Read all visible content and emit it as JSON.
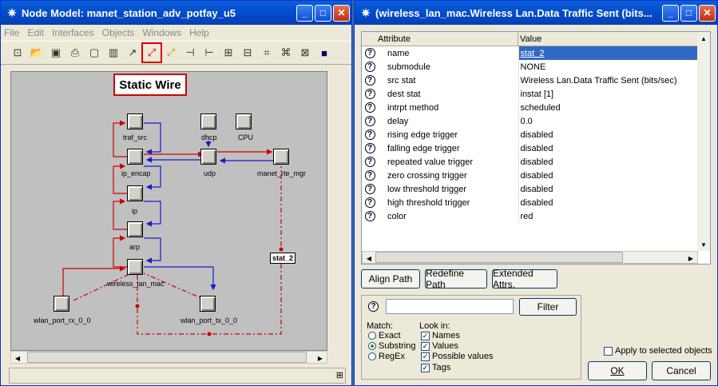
{
  "left_window": {
    "title": "Node Model: manet_station_adv_potfay_u5",
    "menu": [
      "File",
      "Edit",
      "Interfaces",
      "Objects",
      "Windows",
      "Help"
    ],
    "tooltip": "Static Wire",
    "nodes": {
      "traf_src": "traf_src",
      "ip_encap": "ip_encap",
      "ip": "ip",
      "arp": "arp",
      "wireless_lan_mac": "wireless_lan_mac",
      "dhcp": "dhcp",
      "cpu": "CPU",
      "udp": "udp",
      "manet_rte_mgr": "manet_rte_mgr",
      "wlan_port_rx": "wlan_port_rx_0_0",
      "wlan_port_tx": "wlan_port_tx_0_0",
      "stat_tag": "stat_2"
    },
    "colors": {
      "wire_red": "#cc0000",
      "wire_blue": "#1a1acc",
      "highlight": "#d00000"
    }
  },
  "right_window": {
    "title": "(wireless_lan_mac.Wireless Lan.Data Traffic Sent (bits...",
    "columns": {
      "attribute": "Attribute",
      "value": "Value"
    },
    "rows": [
      {
        "name": "name",
        "value": "stat_2"
      },
      {
        "name": "submodule",
        "value": "NONE"
      },
      {
        "name": "src stat",
        "value": "Wireless Lan.Data Traffic Sent (bits/sec)"
      },
      {
        "name": "dest stat",
        "value": "instat [1]"
      },
      {
        "name": "intrpt method",
        "value": "scheduled"
      },
      {
        "name": "delay",
        "value": "0.0"
      },
      {
        "name": "rising edge trigger",
        "value": "disabled"
      },
      {
        "name": "falling edge trigger",
        "value": "disabled"
      },
      {
        "name": "repeated value trigger",
        "value": "disabled"
      },
      {
        "name": "zero crossing trigger",
        "value": "disabled"
      },
      {
        "name": "low threshold trigger",
        "value": "disabled"
      },
      {
        "name": "high threshold trigger",
        "value": "disabled"
      },
      {
        "name": "color",
        "value": "red"
      }
    ],
    "buttons": {
      "align_path": "Align Path",
      "redefine_path": "Redefine Path",
      "extended_attrs": "Extended Attrs.",
      "filter": "Filter",
      "ok": "OK",
      "cancel": "Cancel"
    },
    "filter": {
      "value": "",
      "match_label": "Match:",
      "match_options": [
        "Exact",
        "Substring",
        "RegEx"
      ],
      "match_selected": "Substring",
      "lookin_label": "Look in:",
      "lookin_options": [
        "Names",
        "Values",
        "Possible values",
        "Tags"
      ]
    },
    "apply_selected": "Apply to selected objects"
  }
}
